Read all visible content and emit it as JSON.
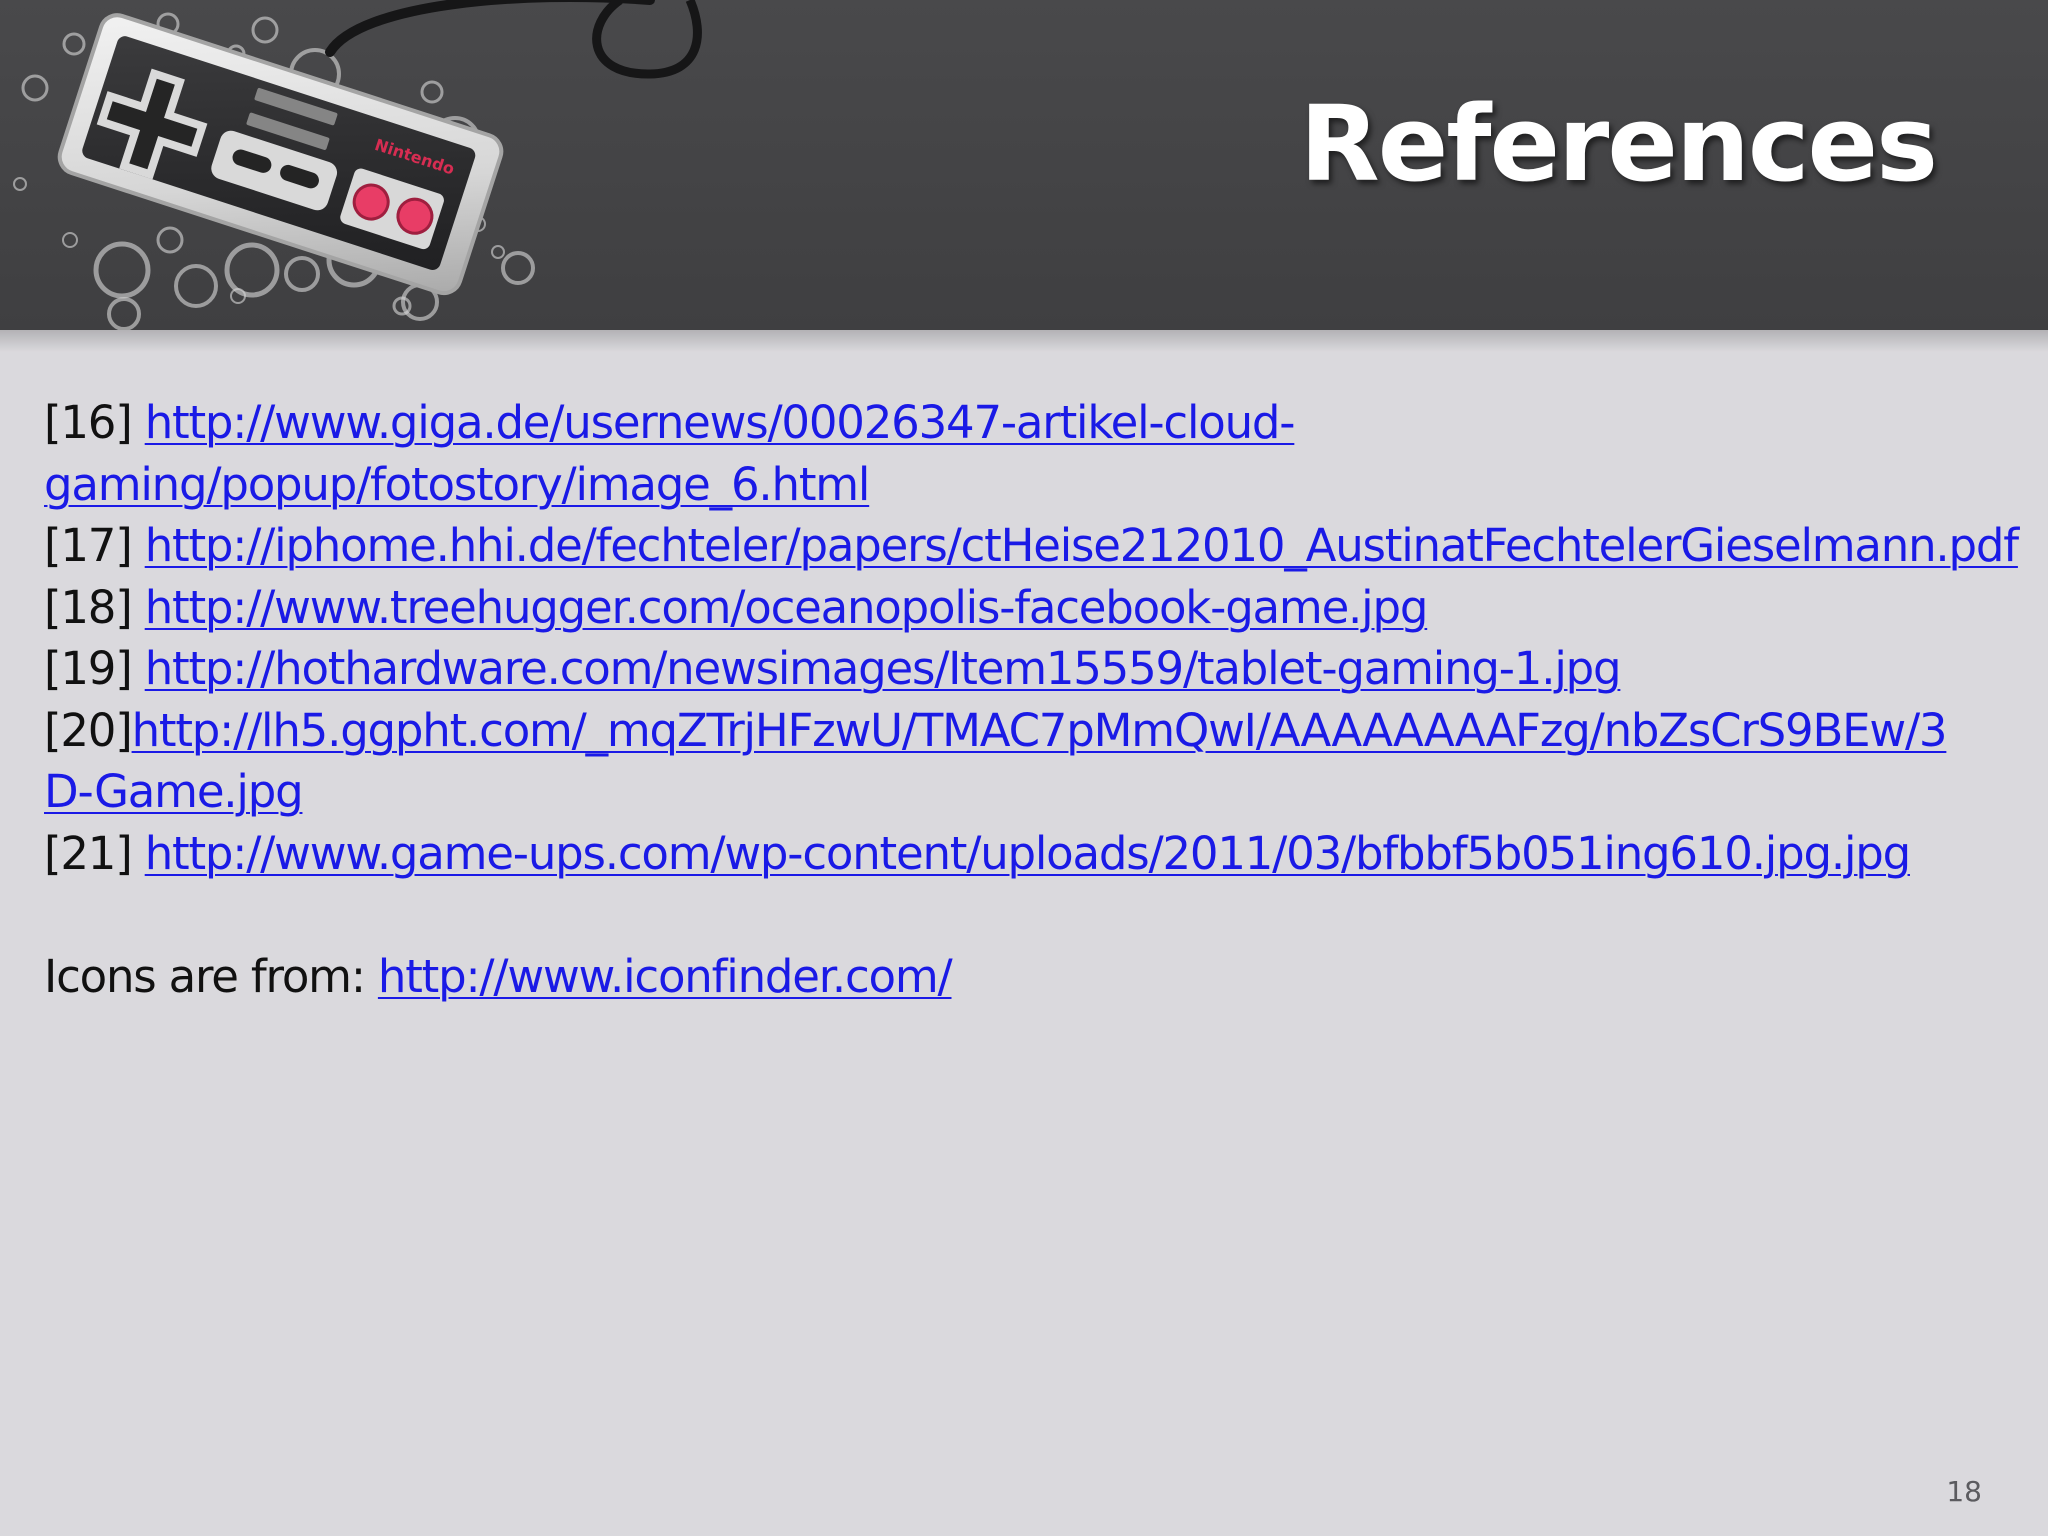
{
  "slide": {
    "title": "References",
    "controller_brand_text": "Nintendo",
    "page_number": "18"
  },
  "references": [
    {
      "number": "[16] ",
      "line_1": "http://www.giga.de/usernews/00026347-artikel-cloud-",
      "line_2": "gaming/popup/fotostory/image_6.html"
    },
    {
      "number": "[17] ",
      "url": "http://iphome.hhi.de/fechteler/papers/ctHeise212010_AustinatFechtelerGieselmann.pdf"
    },
    {
      "number": "[18] ",
      "url": "http://www.treehugger.com/oceanopolis-facebook-game.jpg"
    },
    {
      "number": "[19] ",
      "url": "http://hothardware.com/newsimages/Item15559/tablet-gaming-1.jpg"
    },
    {
      "number": "[20]",
      "line_1": "http://lh5.ggpht.com/_mqZTrjHFzwU/TMAC7pMmQwI/AAAAAAAAFzg/nbZsCrS9BEw/3",
      "line_2": "D-Game.jpg"
    },
    {
      "number": "[21] ",
      "url": "http://www.game-ups.com/wp-content/uploads/2011/03/bfbbf5b051ing610.jpg.jpg"
    }
  ],
  "icons_credit": {
    "label": "Icons are from: ",
    "url": "http://www.iconfinder.com/"
  },
  "icons": {
    "controller": "game-controller-icon"
  },
  "colors": {
    "header": "#444446",
    "background": "#dad9dd",
    "link": "#1a1ae6",
    "title": "#ffffff"
  }
}
